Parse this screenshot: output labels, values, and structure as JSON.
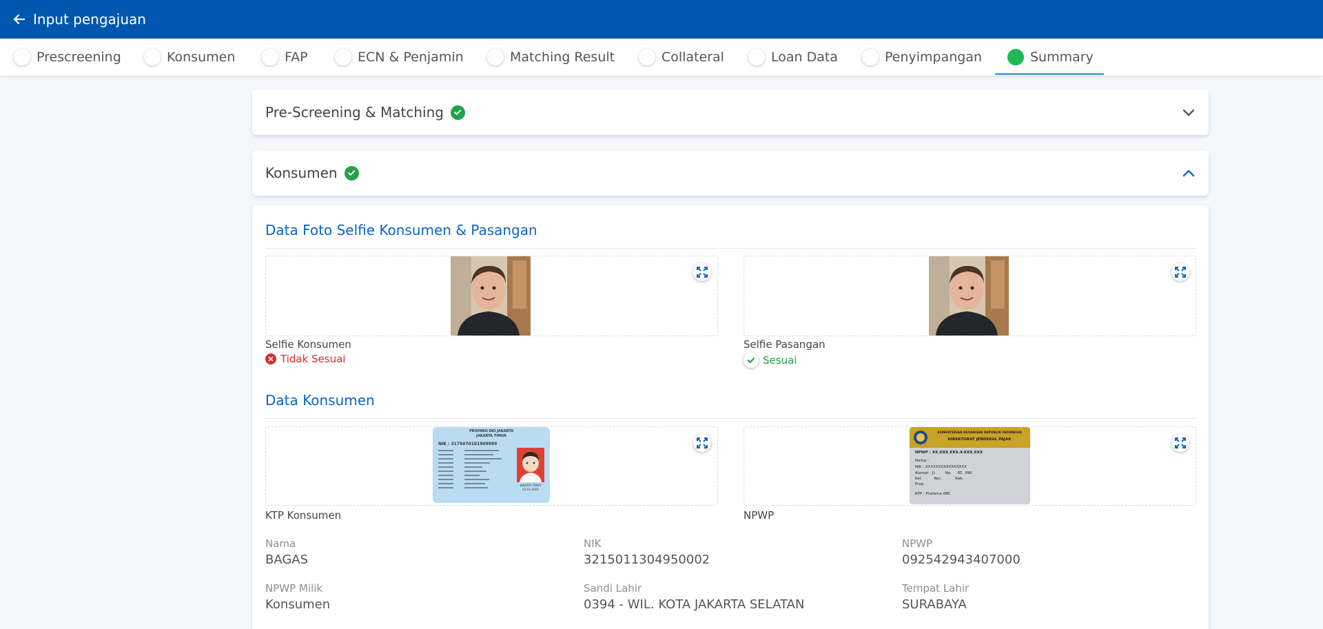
{
  "header": {
    "title": "Input pengajuan"
  },
  "tabs": [
    {
      "label": "Prescreening"
    },
    {
      "label": "Konsumen"
    },
    {
      "label": "FAP"
    },
    {
      "label": "ECN & Penjamin"
    },
    {
      "label": "Matching Result"
    },
    {
      "label": "Collateral"
    },
    {
      "label": "Loan Data"
    },
    {
      "label": "Penyimpangan"
    },
    {
      "label": "Summary"
    }
  ],
  "active_tab": "Summary",
  "accordions": {
    "prescreening": {
      "title": "Pre-Screening & Matching",
      "expanded": false
    },
    "konsumen": {
      "title": "Konsumen",
      "expanded": true
    }
  },
  "selfie_section": {
    "title": "Data Foto Selfie Konsumen & Pasangan",
    "consumer": {
      "caption": "Selfie Konsumen",
      "status": "Tidak Sesuai"
    },
    "spouse": {
      "caption": "Selfie Pasangan",
      "status": "Sesuai"
    }
  },
  "consumer_section": {
    "title": "Data Konsumen",
    "ktp": {
      "caption": "KTP Konsumen",
      "card": {
        "province": "PROVINSI DKI JAKARTA",
        "city": "JAKARTA TIMUR",
        "nik": "NIK : 3175070101909999",
        "footer_city": "JAKARTA TIMUR",
        "footer_date": "01-01-2020"
      }
    },
    "npwp": {
      "caption": "NPWP",
      "card": {
        "line1": "KEMENTERIAN KEUANGAN REPUBLIK INDONESIA",
        "line2": "DIREKTORAT JENDERAL PAJAK",
        "npwp": "NPWP : XX.XXX.XXX.X-XXX.XXX",
        "nama": "Nama :",
        "nik": "NIK   : XXXXXXXXXXXXXXXX",
        "alamat": "Alamat : Jl.        No.     RT.  RW.",
        "kel": "Kel.          Kec.           Kab.",
        "prop": "Prop.",
        "kpp": "KPP   : Pratama ABC"
      }
    },
    "fields": [
      {
        "label": "Nama",
        "value": "BAGAS"
      },
      {
        "label": "NIK",
        "value": "3215011304950002"
      },
      {
        "label": "NPWP",
        "value": "092542943407000"
      },
      {
        "label": "NPWP Milik",
        "value": "Konsumen"
      },
      {
        "label": "Sandi Lahir",
        "value": "0394 - WIL. KOTA JAKARTA SELATAN"
      },
      {
        "label": "Tempat Lahir",
        "value": "SURABAYA"
      }
    ]
  },
  "colors": {
    "primary": "#0157ad",
    "success": "#1db954",
    "error": "#d62c2c",
    "section_title": "#0a66c2"
  }
}
